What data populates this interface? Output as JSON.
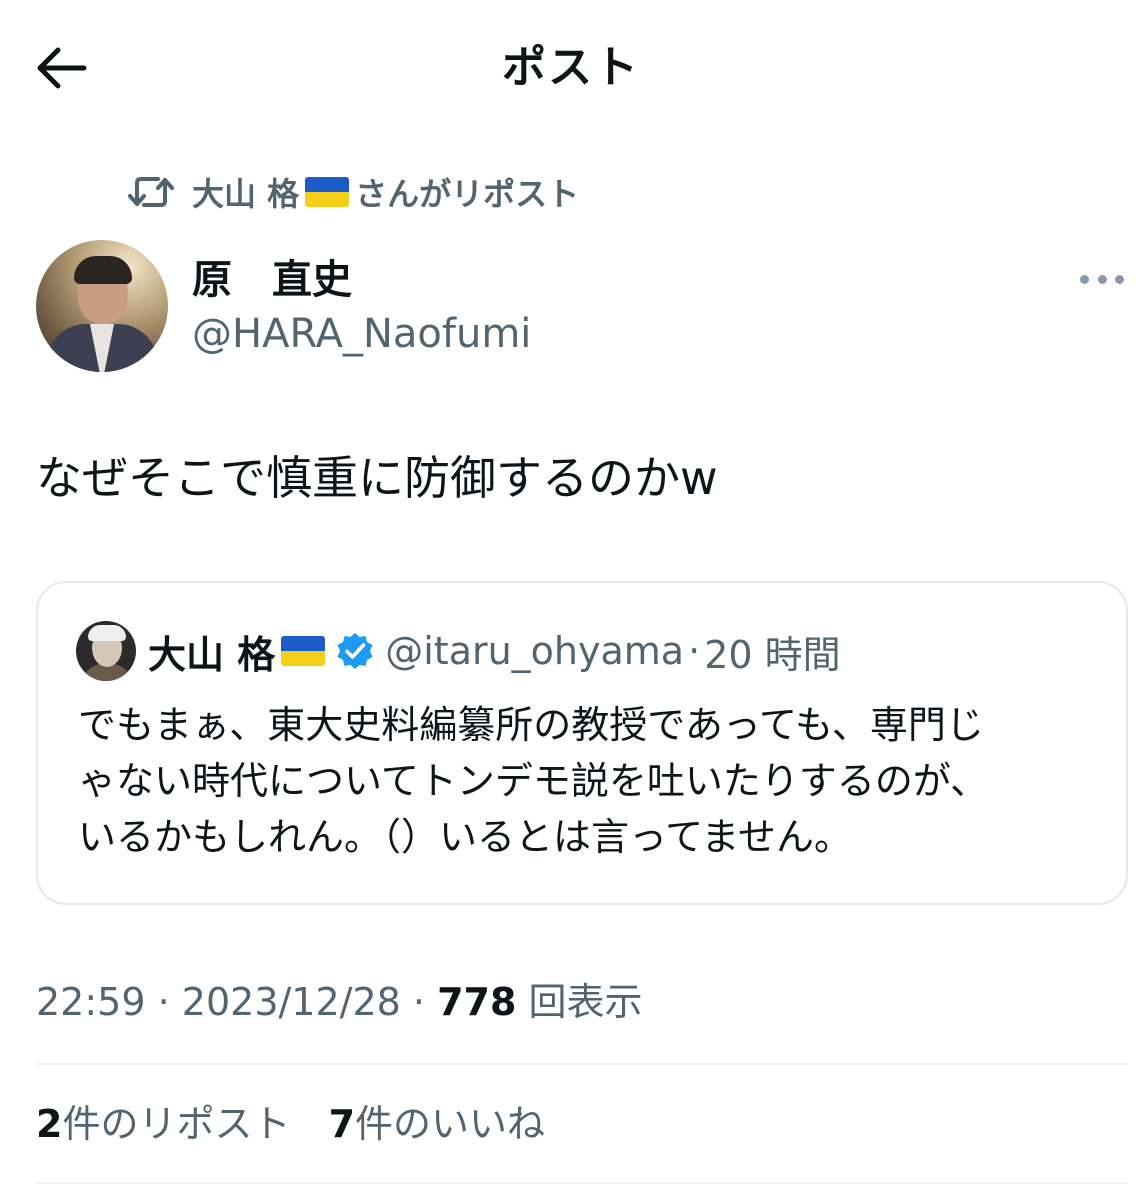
{
  "header": {
    "title": "ポスト"
  },
  "repost": {
    "reposter_name": "大山 格",
    "suffix": "さんがリポスト"
  },
  "author": {
    "display_name": "原　直史",
    "handle": "@HARA_Naofumi"
  },
  "post": {
    "text": "なぜそこで慎重に防御するのかw"
  },
  "quote": {
    "name": "大山 格",
    "handle": "@itaru_ohyama",
    "separator": "·",
    "time": "20 時間",
    "text": "でもまぁ、東大史料編纂所の教授であっても、専門じ\nゃない時代についてトンデモ説を吐いたりするのが、\nいるかもしれん。（）いるとは言ってません。"
  },
  "meta": {
    "time": "22:59",
    "separator": "·",
    "date": "2023/12/28",
    "views_count": "778",
    "views_label": "回表示"
  },
  "stats": {
    "reposts_count": "2",
    "reposts_label": "件のリポスト",
    "likes_count": "7",
    "likes_label": "件のいいね"
  },
  "colors": {
    "text_primary": "#0f1419",
    "text_secondary": "#536471",
    "verified_blue": "#1d9bf0",
    "flag_blue": "#1c5cc9",
    "flag_yellow": "#f6cf1b",
    "border": "#e3e8ec"
  },
  "icons": {
    "back": "arrow-left-icon",
    "repost": "repost-icon",
    "more": "more-dots-icon",
    "verified": "verified-badge-icon",
    "flag": "ukraine-flag-icon"
  }
}
